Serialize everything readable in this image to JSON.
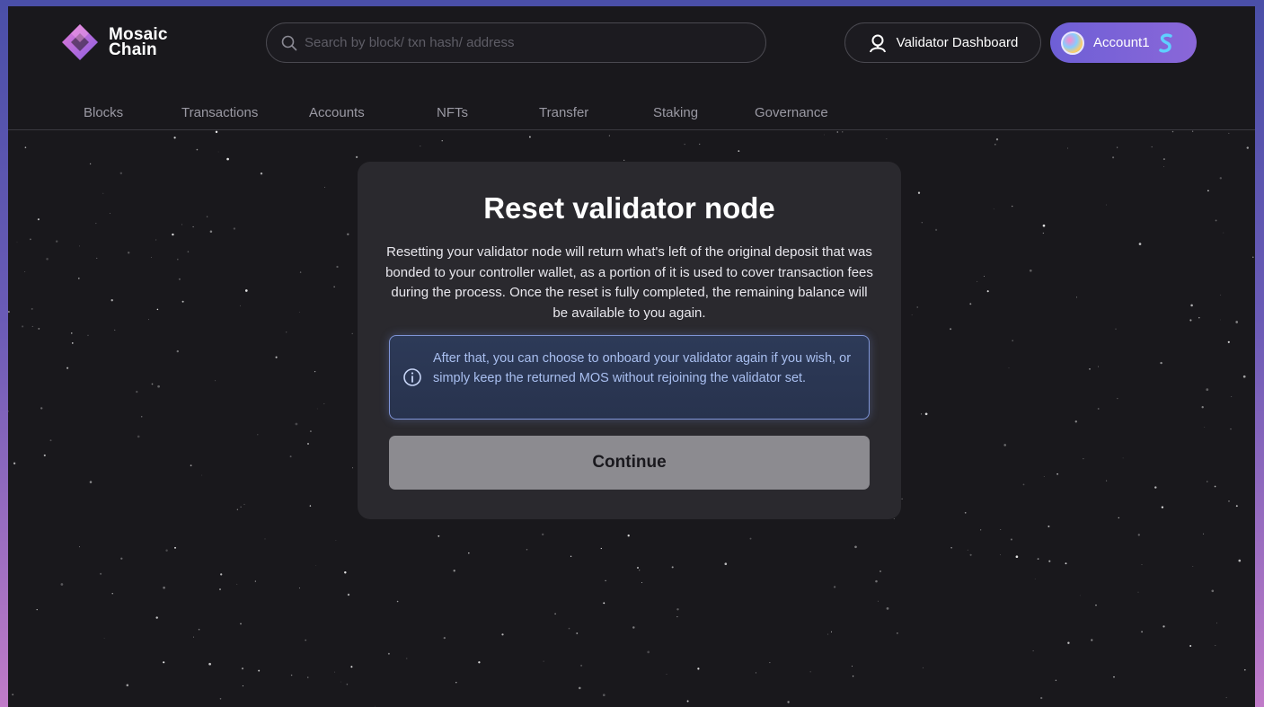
{
  "app": {
    "logo_line1": "Mosaic",
    "logo_line2": "Chain",
    "logo_icon": "diamond-logo-icon",
    "brand_color": "#a070e8"
  },
  "header": {
    "search": {
      "placeholder": "Search by block/ txn hash/ address",
      "icon": "search-icon"
    },
    "validator_dashboard_label": "Validator Dashboard",
    "validator_icon": "validator-user-icon",
    "account_label": "Account1",
    "account_wallet_icon": "wallet-s-icon"
  },
  "nav": {
    "items": [
      {
        "label": "Blocks"
      },
      {
        "label": "Transactions"
      },
      {
        "label": "Accounts"
      },
      {
        "label": "NFTs"
      },
      {
        "label": "Transfer"
      },
      {
        "label": "Staking"
      },
      {
        "label": "Governance"
      }
    ]
  },
  "modal": {
    "title": "Reset validator node",
    "body": "Resetting your validator node will return what's left of the original deposit that was bonded to your controller wallet, as a portion of it is used to cover transaction fees during the process. Once the reset is fully completed, the remaining balance will be available to you again.",
    "info_icon": "info-circle-icon",
    "info_text": "After that, you can choose to onboard your validator again if you wish, or simply keep the returned MOS without rejoining the validator set.",
    "continue_label": "Continue"
  }
}
